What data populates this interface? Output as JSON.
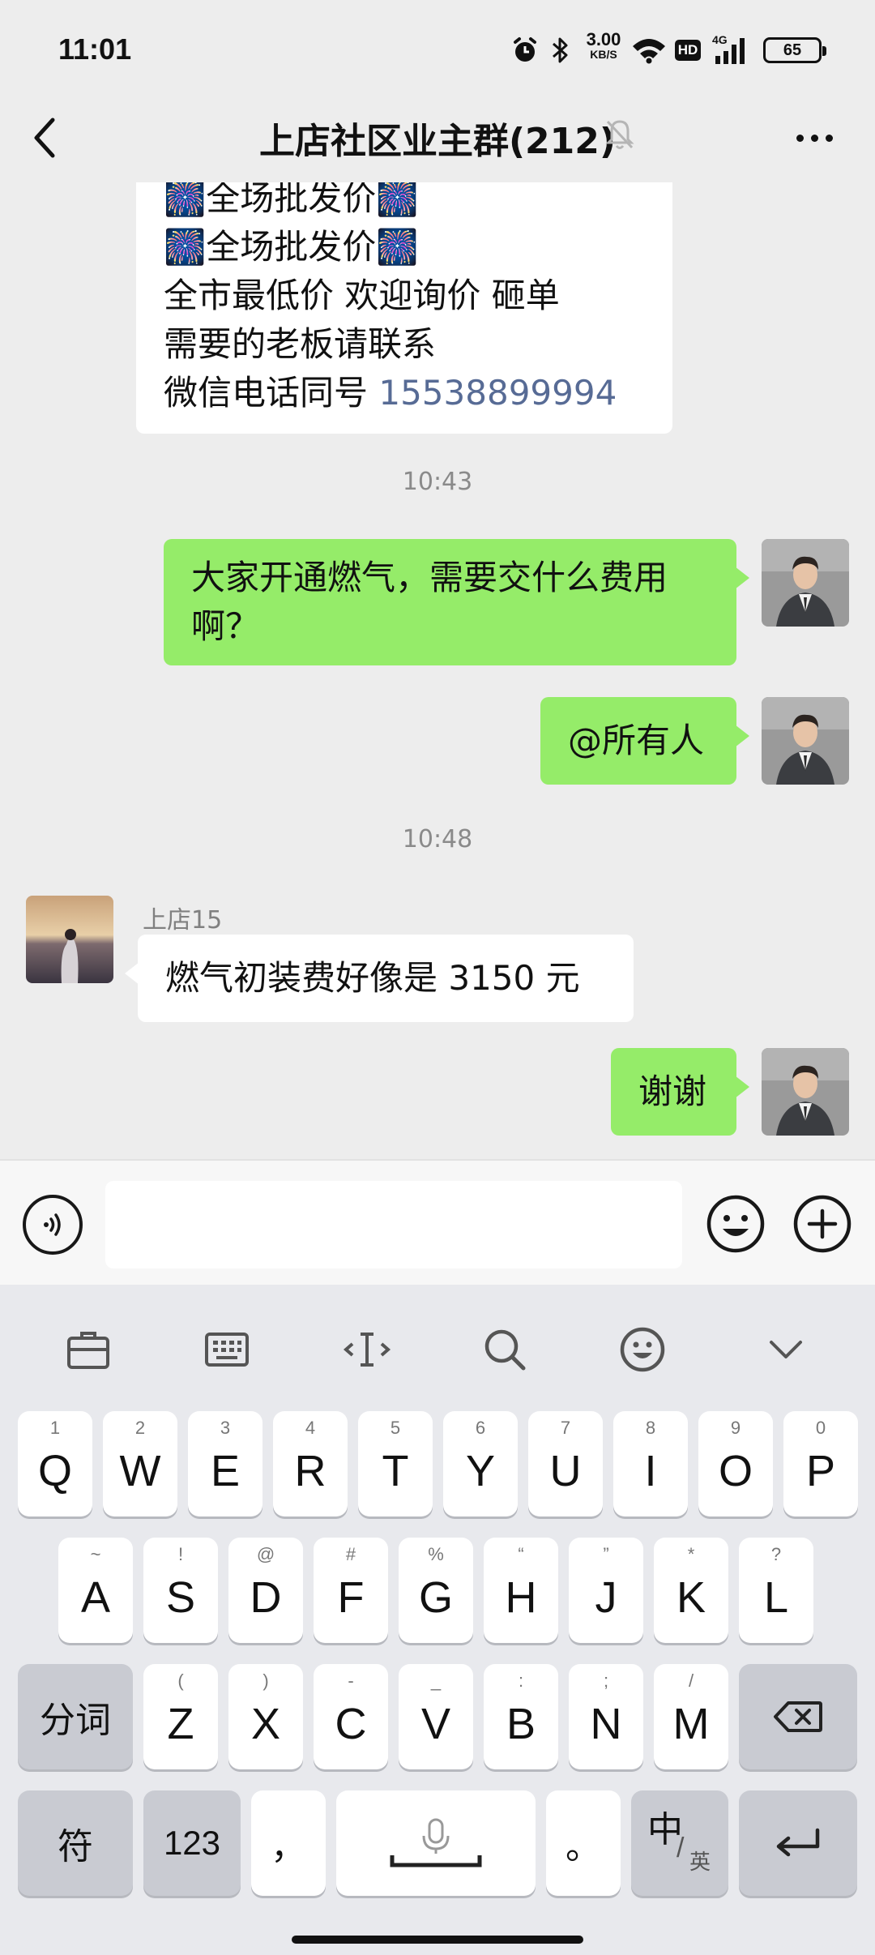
{
  "status_bar": {
    "time": "11:01",
    "net_speed_value": "3.00",
    "net_speed_unit": "KB/S",
    "network_type": "4G",
    "hd_label": "HD",
    "battery": "65"
  },
  "header": {
    "title": "上店社区业主群(212)"
  },
  "messages": {
    "ad_lines": [
      "🎆全场批发价🎆",
      "🎆全场批发价🎆",
      "全市最低价  欢迎询价 砸单",
      "需要的老板请联系"
    ],
    "ad_phone_prefix": "微信电话同号  ",
    "ad_phone": "15538899994",
    "time1": "10:43",
    "msg1": "大家开通燃气，需要交什么费用啊？",
    "msg1_line1": "大家开通燃气，需要交什么费用",
    "msg1_line2": "啊？",
    "msg2": "@所有人",
    "time2": "10:48",
    "sender3": "上店15",
    "msg3": "燃气初装费好像是 3150 元",
    "msg4": "谢谢"
  },
  "keyboard": {
    "row1": [
      {
        "main": "Q",
        "sub": "1"
      },
      {
        "main": "W",
        "sub": "2"
      },
      {
        "main": "E",
        "sub": "3"
      },
      {
        "main": "R",
        "sub": "4"
      },
      {
        "main": "T",
        "sub": "5"
      },
      {
        "main": "Y",
        "sub": "6"
      },
      {
        "main": "U",
        "sub": "7"
      },
      {
        "main": "I",
        "sub": "8"
      },
      {
        "main": "O",
        "sub": "9"
      },
      {
        "main": "P",
        "sub": "0"
      }
    ],
    "row2": [
      {
        "main": "A",
        "sub": "~"
      },
      {
        "main": "S",
        "sub": "!"
      },
      {
        "main": "D",
        "sub": "@"
      },
      {
        "main": "F",
        "sub": "#"
      },
      {
        "main": "G",
        "sub": "%"
      },
      {
        "main": "H",
        "sub": "“"
      },
      {
        "main": "J",
        "sub": "”"
      },
      {
        "main": "K",
        "sub": "*"
      },
      {
        "main": "L",
        "sub": "?"
      }
    ],
    "row3": [
      {
        "main": "Z",
        "sub": "("
      },
      {
        "main": "X",
        "sub": ")"
      },
      {
        "main": "C",
        "sub": "-"
      },
      {
        "main": "V",
        "sub": "_"
      },
      {
        "main": "B",
        "sub": ":"
      },
      {
        "main": "N",
        "sub": ";"
      },
      {
        "main": "M",
        "sub": "/"
      }
    ],
    "segment_key": "分词",
    "symbol_key": "符",
    "num_key": "123",
    "comma_key": "，",
    "period_key": "。",
    "lang_key_main": "中",
    "lang_key_sub": "英"
  },
  "colors": {
    "sent_bubble": "#95ec69",
    "received_bubble": "#ffffff",
    "link": "#576b95",
    "background": "#ededed"
  }
}
